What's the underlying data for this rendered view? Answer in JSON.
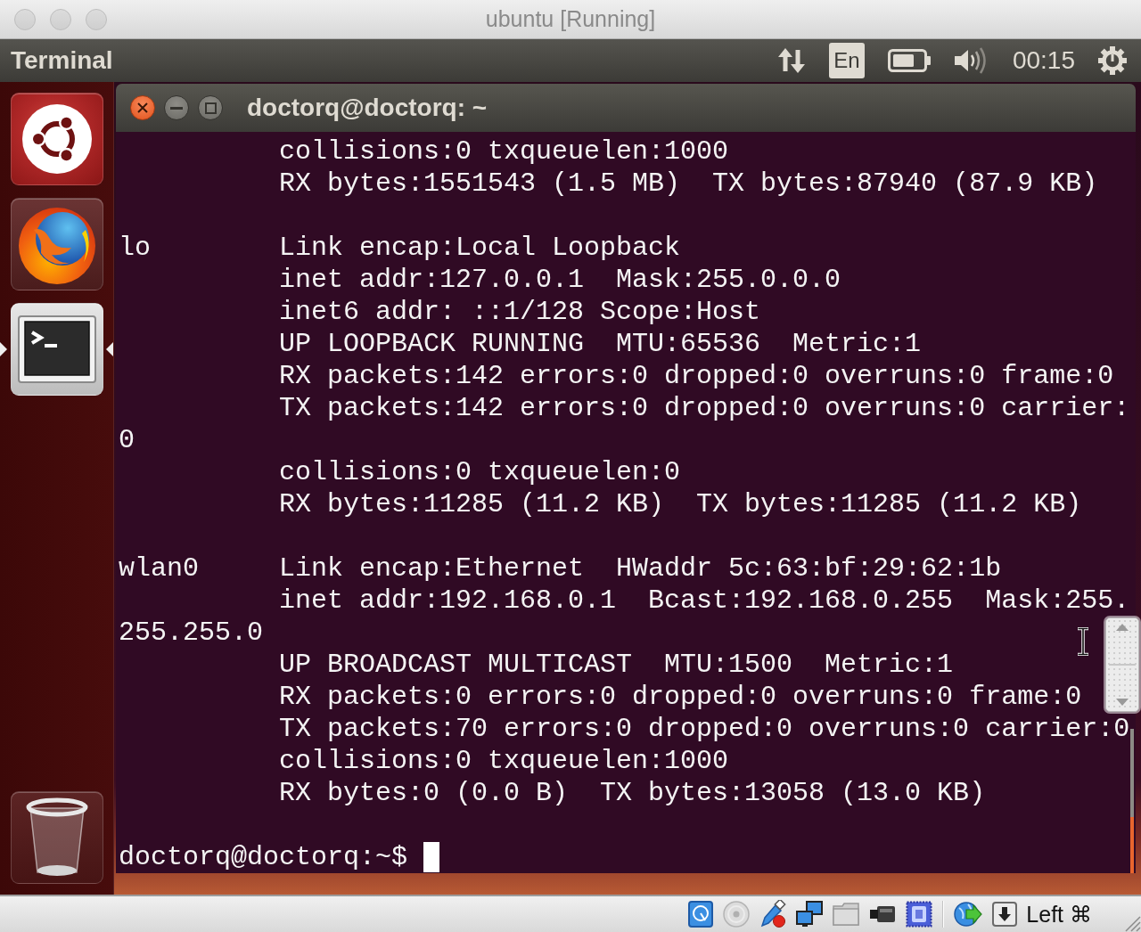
{
  "window": {
    "title": "ubuntu [Running]"
  },
  "panel": {
    "app_title": "Terminal",
    "keyboard_layout": "En",
    "clock": "00:15"
  },
  "launcher": {
    "items": [
      {
        "kind": "dash",
        "running": false,
        "focused": false
      },
      {
        "kind": "browser",
        "running": false,
        "focused": false
      },
      {
        "kind": "terminal",
        "running": true,
        "focused": true
      },
      {
        "kind": "trash",
        "running": false,
        "focused": false
      }
    ]
  },
  "terminal": {
    "title": "doctorq@doctorq: ~",
    "lines": [
      {
        "kind": "detail",
        "text": "collisions:0 txqueuelen:1000"
      },
      {
        "kind": "detail",
        "text": "RX bytes:1551543 (1.5 MB)  TX bytes:87940 (87.9 KB)"
      },
      {
        "kind": "blank"
      },
      {
        "kind": "interface",
        "name": "lo",
        "text": "Link encap:Local Loopback"
      },
      {
        "kind": "detail",
        "text": "inet addr:127.0.0.1  Mask:255.0.0.0"
      },
      {
        "kind": "detail",
        "text": "inet6 addr: ::1/128 Scope:Host"
      },
      {
        "kind": "detail",
        "text": "UP LOOPBACK RUNNING  MTU:65536  Metric:1"
      },
      {
        "kind": "detail",
        "text": "RX packets:142 errors:0 dropped:0 overruns:0 frame:0"
      },
      {
        "kind": "detail",
        "text": "TX packets:142 errors:0 dropped:0 overruns:0 carrier:"
      },
      {
        "kind": "wrap",
        "text": "0"
      },
      {
        "kind": "detail",
        "text": "collisions:0 txqueuelen:0"
      },
      {
        "kind": "detail",
        "text": "RX bytes:11285 (11.2 KB)  TX bytes:11285 (11.2 KB)"
      },
      {
        "kind": "blank"
      },
      {
        "kind": "interface",
        "name": "wlan0",
        "text": "Link encap:Ethernet  HWaddr 5c:63:bf:29:62:1b"
      },
      {
        "kind": "detail",
        "text": "inet addr:192.168.0.1  Bcast:192.168.0.255  Mask:255."
      },
      {
        "kind": "wrap",
        "text": "255.255.0"
      },
      {
        "kind": "detail",
        "text": "UP BROADCAST MULTICAST  MTU:1500  Metric:1"
      },
      {
        "kind": "detail",
        "text": "RX packets:0 errors:0 dropped:0 overruns:0 frame:0"
      },
      {
        "kind": "detail",
        "text": "TX packets:70 errors:0 dropped:0 overruns:0 carrier:0"
      },
      {
        "kind": "detail",
        "text": "collisions:0 txqueuelen:1000"
      },
      {
        "kind": "detail",
        "text": "RX bytes:0 (0.0 B)  TX bytes:13058 (13.0 KB)"
      },
      {
        "kind": "blank"
      }
    ],
    "prompt": "doctorq@doctorq:~$"
  },
  "status_bar": {
    "host_key": "Left ⌘"
  }
}
